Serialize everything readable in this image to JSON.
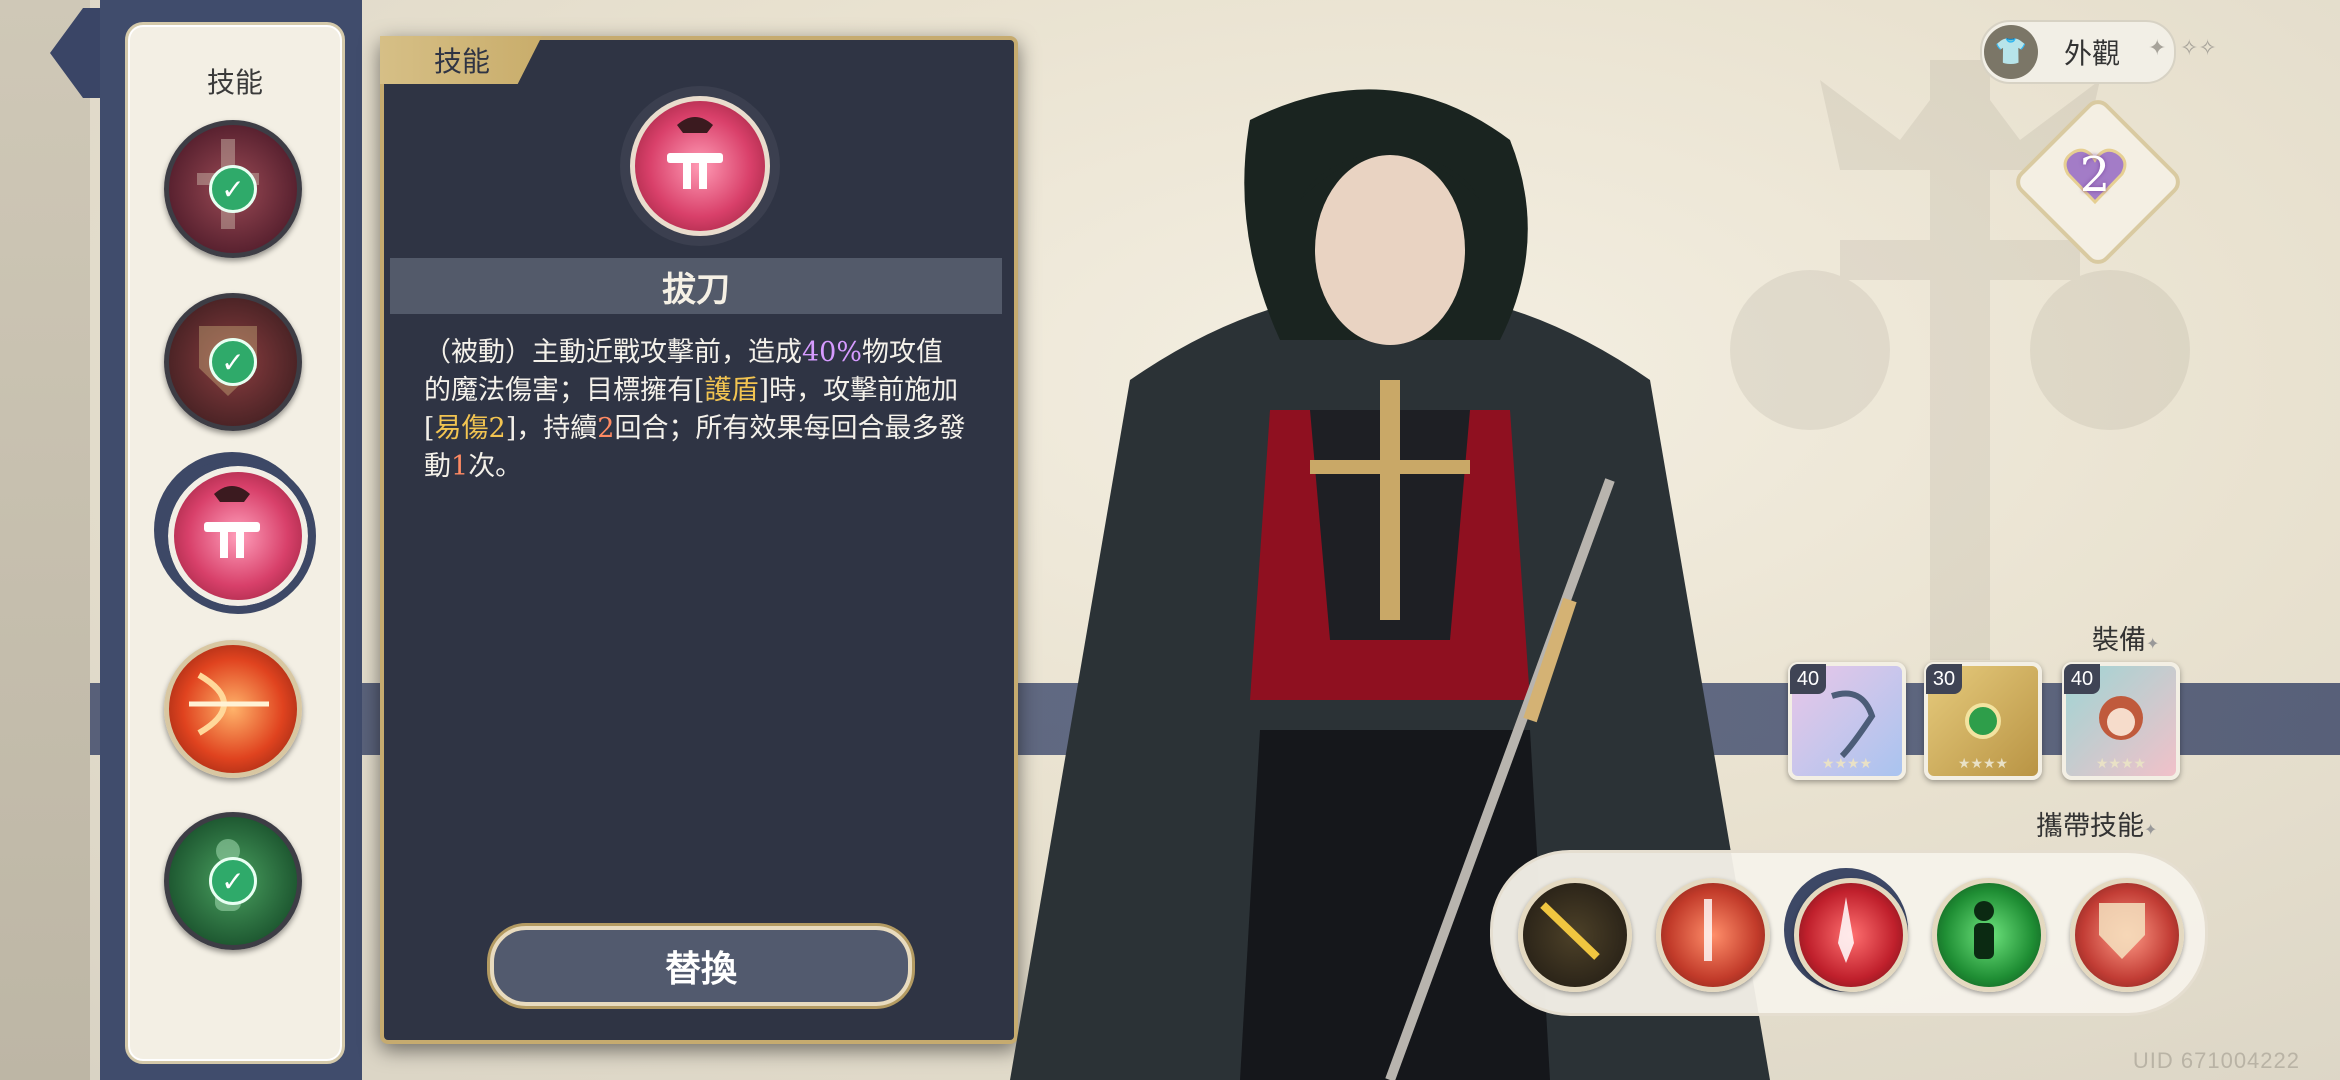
{
  "detail": {
    "tab_label": "技能",
    "skill_name": "拔刀",
    "desc_lines": [
      {
        "parts": [
          {
            "t": "（被動）主動近戰攻擊前，造成",
            "c": ""
          },
          {
            "t": "40%",
            "c": "hl-purple"
          },
          {
            "t": "物攻值",
            "c": ""
          }
        ]
      },
      {
        "parts": [
          {
            "t": "的魔法傷害；目標擁有[",
            "c": ""
          },
          {
            "t": "護盾",
            "c": "hl-yellow"
          },
          {
            "t": "]時，攻擊前施加",
            "c": ""
          }
        ]
      },
      {
        "parts": [
          {
            "t": "[",
            "c": ""
          },
          {
            "t": "易傷2",
            "c": "hl-yellow"
          },
          {
            "t": "]，持續",
            "c": ""
          },
          {
            "t": "2",
            "c": "hl-red"
          },
          {
            "t": "回合；所有效果每回合最多發",
            "c": ""
          }
        ]
      },
      {
        "parts": [
          {
            "t": "動",
            "c": ""
          },
          {
            "t": "1",
            "c": "hl-red"
          },
          {
            "t": "次。",
            "c": ""
          }
        ]
      }
    ],
    "replace_label": "替換"
  },
  "skill_column": {
    "title": "技能"
  },
  "appearance": {
    "label": "外觀"
  },
  "level_badge": "2",
  "equipment": {
    "label": "裝備",
    "items": [
      {
        "level": "40",
        "name": "equip-1"
      },
      {
        "level": "30",
        "name": "equip-2"
      },
      {
        "level": "40",
        "name": "equip-3"
      }
    ]
  },
  "carry_skills": {
    "label": "攜帶技能"
  },
  "uid_text": "UID 671004222"
}
